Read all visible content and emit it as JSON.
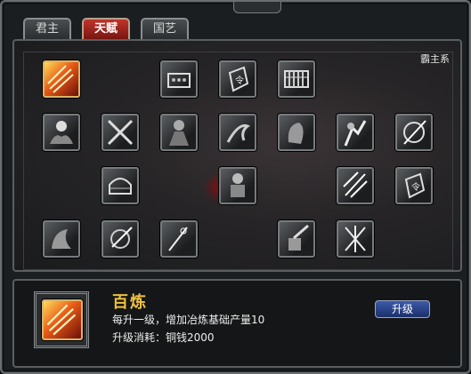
{
  "tabs": [
    {
      "label": "君主",
      "active": false
    },
    {
      "label": "天赋",
      "active": true
    },
    {
      "label": "国艺",
      "active": false
    }
  ],
  "talent_panel": {
    "series_label": "霸主系",
    "skills": [
      {
        "name": "百炼",
        "icon": "flame-burst-icon",
        "selected": true
      },
      {
        "name": "",
        "icon": "treasure-box-icon"
      },
      {
        "name": "",
        "icon": "token-plaque-icon"
      },
      {
        "name": "",
        "icon": "abacus-icon"
      },
      {
        "name": "",
        "icon": "orb-hand-icon"
      },
      {
        "name": "",
        "icon": "crossed-swords-icon"
      },
      {
        "name": "",
        "icon": "ninja-icon"
      },
      {
        "name": "",
        "icon": "dragon-icon"
      },
      {
        "name": "",
        "icon": "warrior-head-icon"
      },
      {
        "name": "",
        "icon": "fighter-strike-icon"
      },
      {
        "name": "",
        "icon": "vortex-slash-icon"
      },
      {
        "name": "",
        "icon": "yurt-icon"
      },
      {
        "name": "",
        "icon": "armored-warrior-icon"
      },
      {
        "name": "",
        "icon": "light-rays-icon"
      },
      {
        "name": "",
        "icon": "token-plaque-icon"
      },
      {
        "name": "",
        "icon": "beast-icon"
      },
      {
        "name": "",
        "icon": "spin-slash-icon"
      },
      {
        "name": "",
        "icon": "spear-thrust-icon"
      },
      {
        "name": "",
        "icon": "blade-fist-icon"
      },
      {
        "name": "",
        "icon": "triple-sword-icon"
      }
    ]
  },
  "selected_skill": {
    "icon": "flame-burst-icon",
    "name": "百炼",
    "description": "每升一级，增加冶炼基础产量10",
    "cost": "升级消耗：铜钱2000",
    "upgrade_label": "升级"
  },
  "colors": {
    "accent_gold": "#f0c040",
    "active_tab": "#b3291f",
    "button_blue": "#2c4a94"
  }
}
